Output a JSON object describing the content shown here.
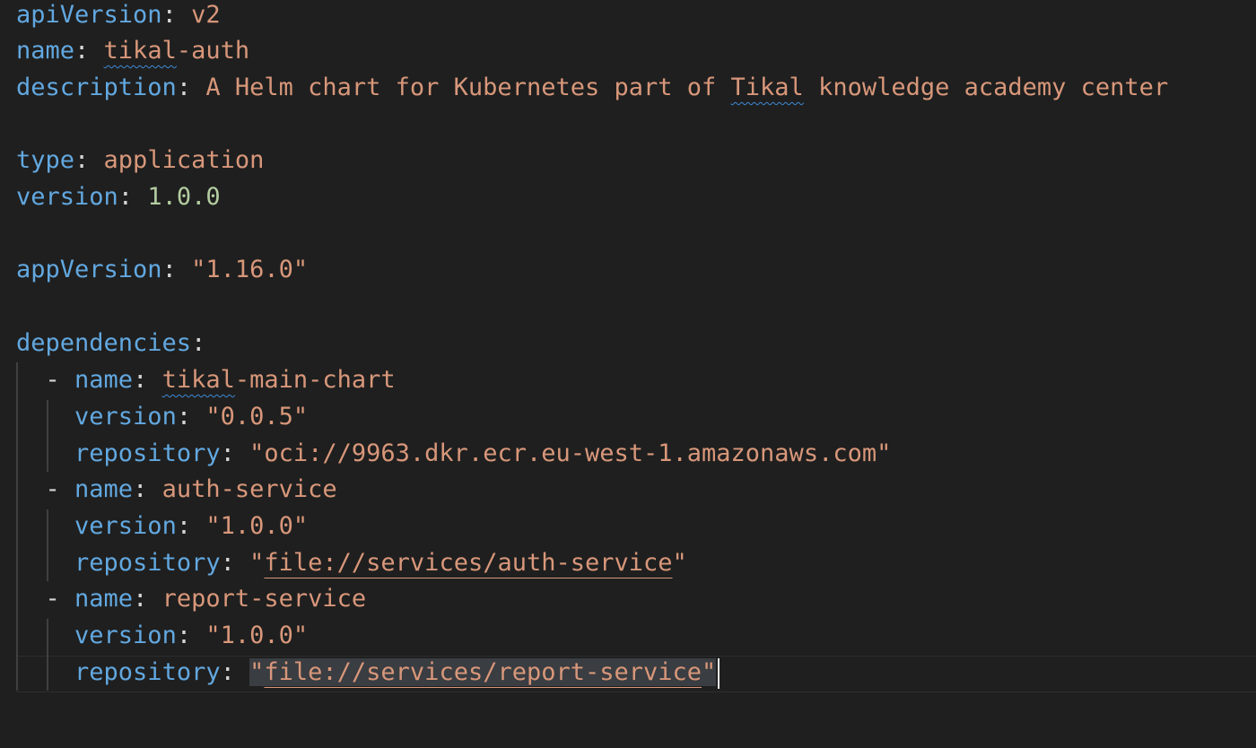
{
  "lines": [
    {
      "key": "apiVersion",
      "value": "v2"
    },
    {
      "key": "name",
      "value_a": "tikal",
      "value_b": "-auth"
    },
    {
      "key": "description",
      "value_a": "A Helm chart for Kubernetes part of ",
      "value_b": "Tikal",
      "value_c": " knowledge academy center"
    },
    {
      "key": "type",
      "value": "application"
    },
    {
      "key": "version",
      "value": "1.0.0"
    },
    {
      "key": "appVersion",
      "value": "\"1.16.0\""
    },
    {
      "key": "dependencies"
    }
  ],
  "dependencies": [
    {
      "name_a": "tikal",
      "name_b": "-main-chart",
      "version": "\"0.0.5\"",
      "repository": "\"oci://9963.dkr.ecr.eu-west-1.amazonaws.com\""
    },
    {
      "name": "auth-service",
      "version": "\"1.0.0\"",
      "repo_q1": "\"",
      "repo_path": "file://services/auth-service",
      "repo_q2": "\""
    },
    {
      "name": "report-service",
      "version": "\"1.0.0\"",
      "repo_q1": "\"",
      "repo_path": "file://services/report-service",
      "repo_q2": "\""
    }
  ],
  "keys": {
    "name": "name",
    "version": "version",
    "repository": "repository",
    "dash": "- ",
    "colon": ": ",
    "colon_only": ":"
  },
  "theme": {
    "background": "#1f1f1f",
    "key_color": "#62a8e0",
    "string_color": "#d8977a",
    "number_color": "#b3cca0"
  }
}
